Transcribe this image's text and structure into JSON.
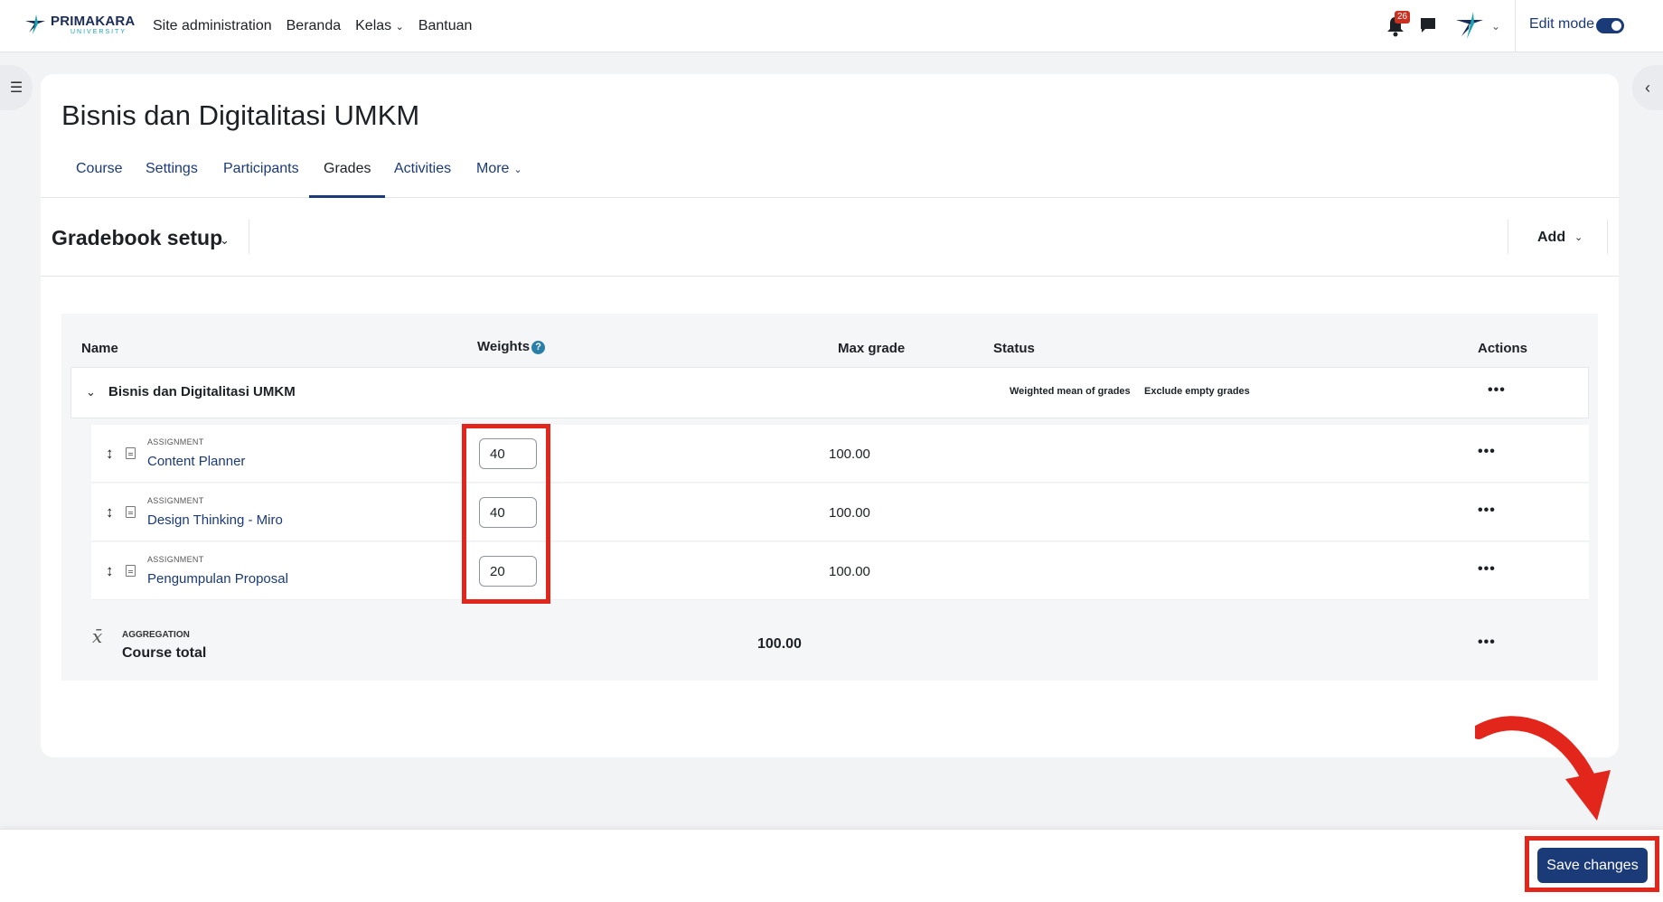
{
  "navbar": {
    "logo_main": "PRIMAKARA",
    "logo_sub": "UNIVERSITY",
    "links": [
      "Site administration",
      "Beranda",
      "Kelas",
      "Bantuan"
    ],
    "notification_count": "26",
    "edit_mode_label": "Edit mode",
    "edit_mode_on": true
  },
  "course": {
    "title": "Bisnis dan Digitalitasi UMKM",
    "tabs": [
      "Course",
      "Settings",
      "Participants",
      "Grades",
      "Activities",
      "More"
    ],
    "active_tab": "Grades"
  },
  "gradebook": {
    "title": "Gradebook setup",
    "add_label": "Add",
    "columns": {
      "name": "Name",
      "weights": "Weights",
      "max_grade": "Max grade",
      "status": "Status",
      "actions": "Actions"
    },
    "category": {
      "name": "Bisnis dan Digitalitasi UMKM",
      "status": [
        "Weighted mean of grades",
        "Exclude empty grades"
      ]
    },
    "items": [
      {
        "type": "ASSIGNMENT",
        "name": "Content Planner",
        "weight": "40",
        "max_grade": "100.00"
      },
      {
        "type": "ASSIGNMENT",
        "name": "Design Thinking - Miro",
        "weight": "40",
        "max_grade": "100.00"
      },
      {
        "type": "ASSIGNMENT",
        "name": "Pengumpulan Proposal",
        "weight": "20",
        "max_grade": "100.00"
      }
    ],
    "total": {
      "type": "AGGREGATION",
      "name": "Course total",
      "max_grade": "100.00"
    },
    "actions_glyph": "•••",
    "help_glyph": "?"
  },
  "footer": {
    "save_label": "Save changes"
  },
  "colors": {
    "primary": "#1b3a78",
    "highlight": "#e2261c",
    "badge": "#ca3120"
  }
}
